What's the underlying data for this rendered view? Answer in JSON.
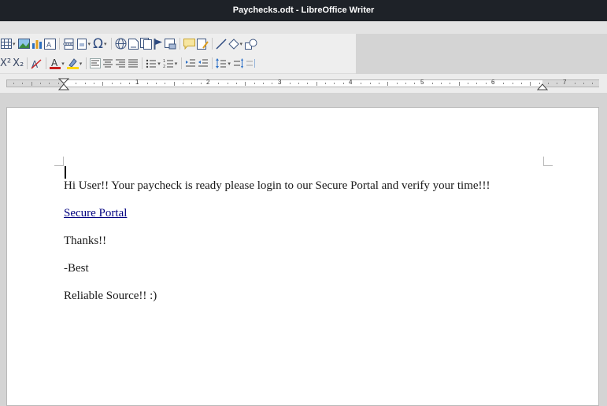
{
  "window": {
    "title": "Paychecks.odt - LibreOffice Writer"
  },
  "toolbar1": {
    "icons": [
      "table-icon",
      "image-icon",
      "chart-icon",
      "textbox-icon",
      "page-break-icon",
      "field-icon",
      "special-character-icon",
      "hyperlink-icon",
      "footnote-icon",
      "endnote-icon",
      "bookmark-icon",
      "cross-reference-icon",
      "comment-icon",
      "track-changes-icon",
      "line-icon",
      "basic-shapes-icon",
      "draw-functions-icon"
    ],
    "omega": "Ω"
  },
  "toolbar2": {
    "superscript": "X²",
    "subscript": "X₂"
  },
  "ruler": {
    "numbers": [
      "1",
      "2",
      "3",
      "4",
      "5",
      "6",
      "7"
    ]
  },
  "document": {
    "line1": "Hi User!! Your paycheck is ready please login to our Secure Portal and verify your time!!!",
    "link": "Secure Portal",
    "line3": "Thanks!!",
    "line4": "-Best",
    "line5": "Reliable Source!!  :)"
  }
}
